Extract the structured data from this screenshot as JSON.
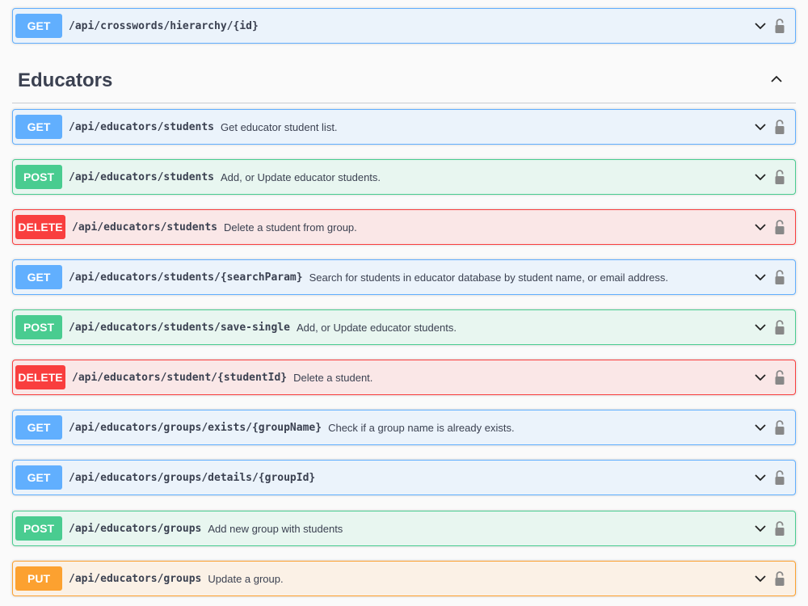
{
  "top_operation": {
    "method": "GET",
    "path": "/api/crosswords/hierarchy/{id}",
    "summary": ""
  },
  "section": {
    "title": "Educators"
  },
  "operations": [
    {
      "method": "GET",
      "path": "/api/educators/students",
      "summary": "Get educator student list."
    },
    {
      "method": "POST",
      "path": "/api/educators/students",
      "summary": "Add, or Update educator students."
    },
    {
      "method": "DELETE",
      "path": "/api/educators/students",
      "summary": "Delete a student from group."
    },
    {
      "method": "GET",
      "path": "/api/educators/students/{searchParam}",
      "summary": "Search for students in educator database by student name, or email address."
    },
    {
      "method": "POST",
      "path": "/api/educators/students/save-single",
      "summary": "Add, or Update educator students."
    },
    {
      "method": "DELETE",
      "path": "/api/educators/student/{studentId}",
      "summary": "Delete a student."
    },
    {
      "method": "GET",
      "path": "/api/educators/groups/exists/{groupName}",
      "summary": "Check if a group name is already exists."
    },
    {
      "method": "GET",
      "path": "/api/educators/groups/details/{groupId}",
      "summary": ""
    },
    {
      "method": "POST",
      "path": "/api/educators/groups",
      "summary": "Add new group with students"
    },
    {
      "method": "PUT",
      "path": "/api/educators/groups",
      "summary": "Update a group."
    }
  ],
  "colors": {
    "get": "#61affe",
    "post": "#49cc90",
    "delete": "#f93e3e",
    "put": "#fca130",
    "text": "#3b4151"
  },
  "icons": {
    "expand": "chevron-down-icon",
    "collapse": "chevron-up-icon",
    "auth": "lock-icon"
  }
}
